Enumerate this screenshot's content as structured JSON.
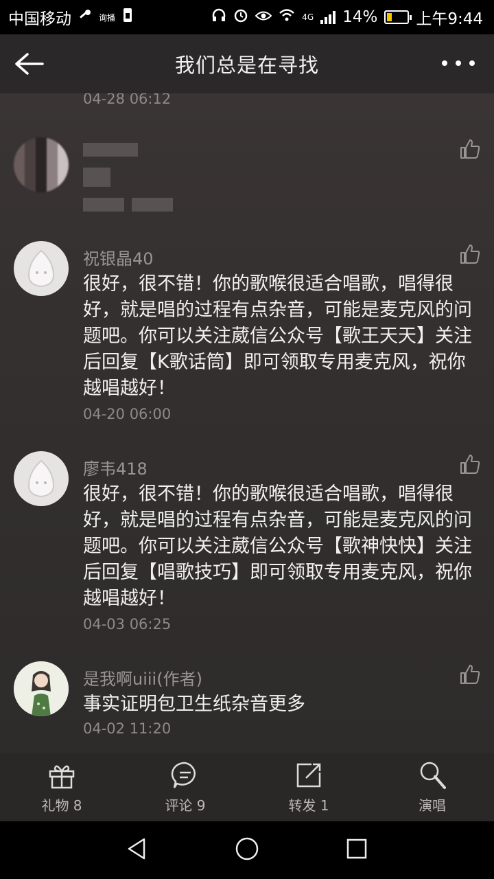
{
  "status_bar": {
    "carrier": "中国移动",
    "hd_label": "询播",
    "network": "4G",
    "battery": "14%",
    "time": "上午9:44"
  },
  "header": {
    "title": "我们总是在寻找"
  },
  "comments": {
    "prev_time": "04-28 06:12",
    "c1": {
      "name": "祝银晶40",
      "text": "很好，很不错！你的歌喉很适合唱歌，唱得很好，就是唱的过程有点杂音，可能是麦克风的问题吧。你可以关注葳信公众号【歌王天天】关注后回复【K歌话筒】即可领取专用麦克风，祝你越唱越好！",
      "time": "04-20 06:00"
    },
    "c2": {
      "name": "廖韦418",
      "text": "很好，很不错！你的歌喉很适合唱歌，唱得很好，就是唱的过程有点杂音，可能是麦克风的问题吧。你可以关注葳信公众号【歌神快快】关注后回复【唱歌技巧】即可领取专用麦克风，祝你越唱越好！",
      "time": "04-03 06:25"
    },
    "c3": {
      "name": "是我啊uiii(作者)",
      "text": "事实证明包卫生纸杂音更多",
      "time": "04-02 11:20"
    }
  },
  "actions": {
    "gift": "礼物 8",
    "comment": "评论 9",
    "share": "转发 1",
    "sing": "演唱"
  },
  "colors": {
    "background": "#2f2b2b",
    "battery_low": "#f5c400"
  }
}
